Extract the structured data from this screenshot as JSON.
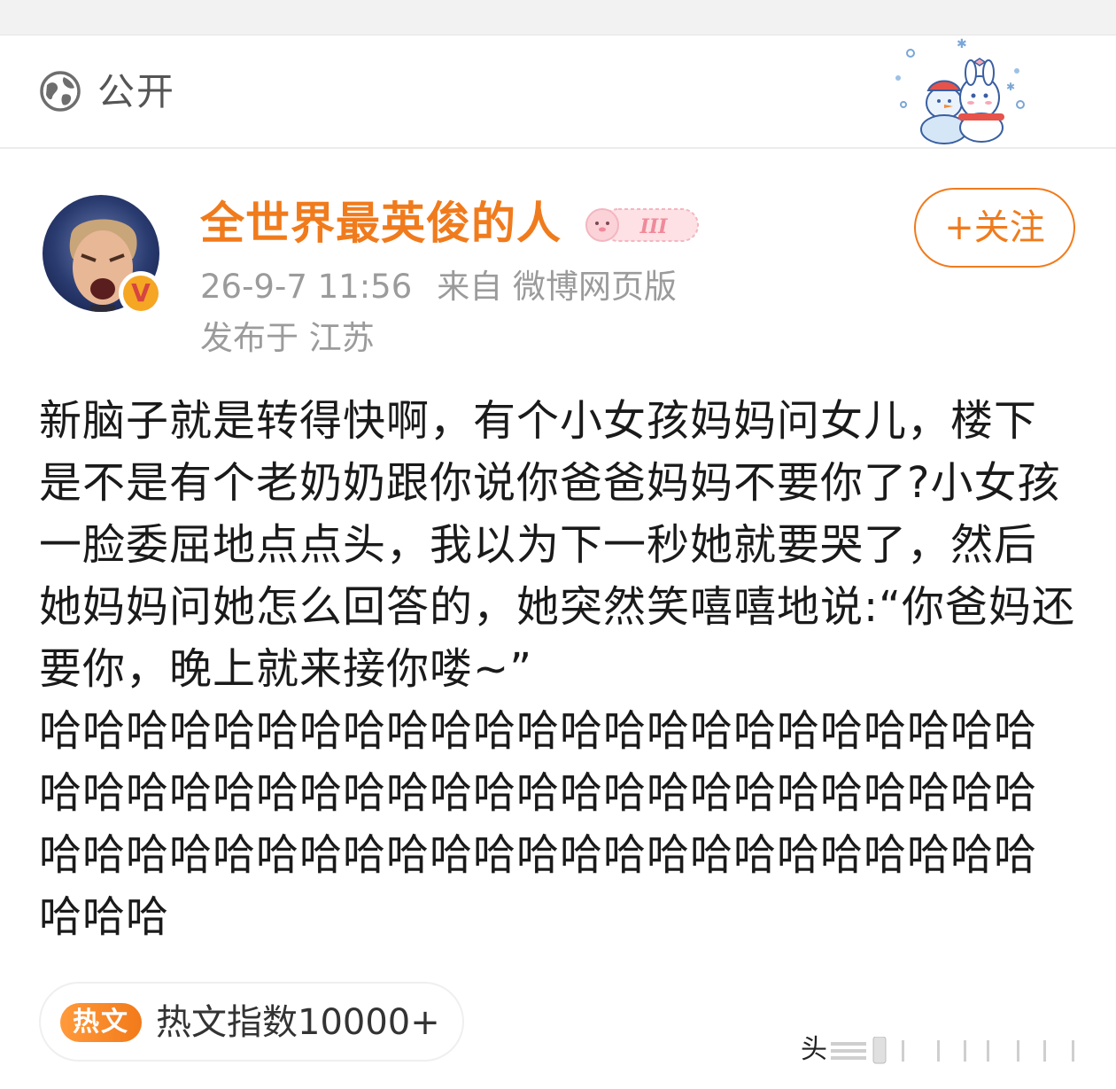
{
  "visibility": {
    "icon": "globe-icon",
    "label": "公开"
  },
  "post": {
    "author": {
      "name": "全世界最英俊的人",
      "verified_badge": "V",
      "level_badge_text": "III"
    },
    "meta": {
      "time": "26-9-7 11:56",
      "source": "来自 微博网页版",
      "location": "发布于 江苏"
    },
    "follow_label": "+关注",
    "content": "新脑子就是转得快啊，有个小女孩妈妈问女儿，楼下是不是有个老奶奶跟你说你爸爸妈妈不要你了?小女孩一脸委屈地点点头，我以为下一秒她就要哭了，然后她妈妈问她怎么回答的，她突然笑嘻嘻地说:“你爸妈还要你，晚上就来接你喽~”\n哈哈哈哈哈哈哈哈哈哈哈哈哈哈哈哈哈哈哈哈哈哈哈哈哈哈哈哈哈哈哈哈哈哈哈哈哈哈哈哈哈哈哈哈哈哈哈哈哈哈哈哈哈哈哈哈哈哈哈哈哈哈哈哈哈哈哈哈哈哈哈哈",
    "hot": {
      "tag": "热文",
      "text": "热文指数10000+"
    }
  },
  "watermark": {
    "text": "头"
  },
  "colors": {
    "accent": "#f07b1d",
    "meta_gray": "#9b9b9b",
    "body_text": "#1a1a1a"
  }
}
